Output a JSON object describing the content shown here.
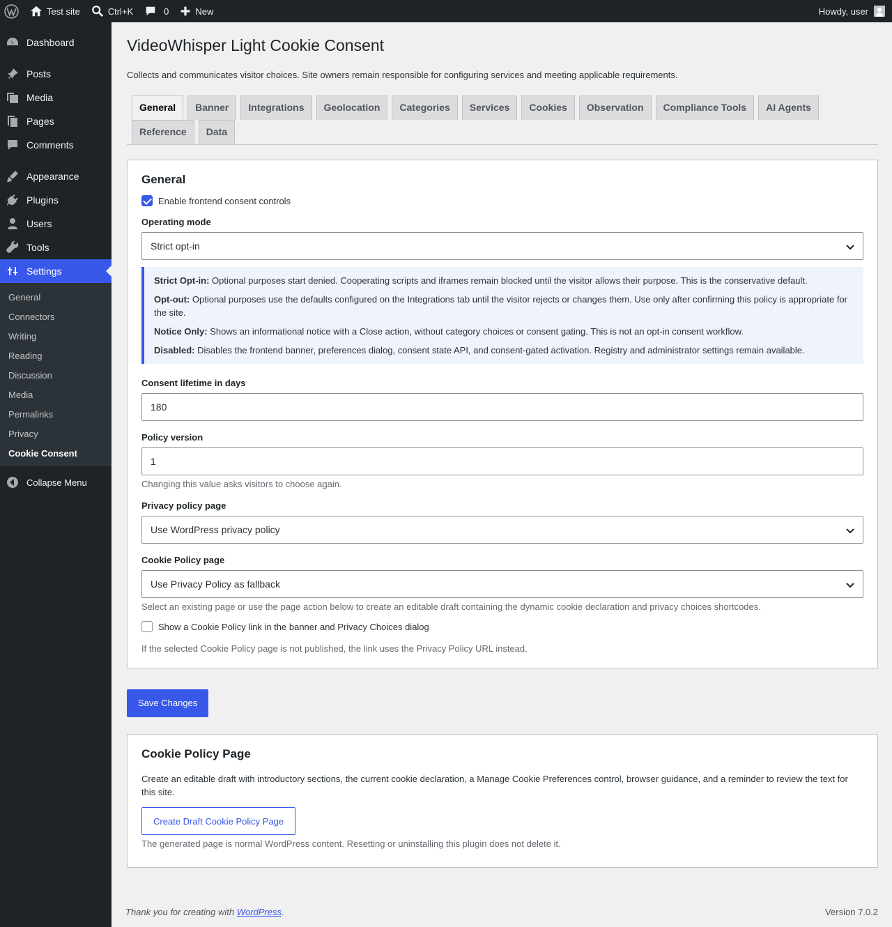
{
  "adminbar": {
    "site_name": "Test site",
    "search_shortcut": "Ctrl+K",
    "comments_count": "0",
    "new_label": "New",
    "howdy": "Howdy, user"
  },
  "sidebar": {
    "items": [
      {
        "label": "Dashboard",
        "icon": "dashboard-icon"
      },
      {
        "label": "Posts",
        "icon": "pin-icon"
      },
      {
        "label": "Media",
        "icon": "media-icon"
      },
      {
        "label": "Pages",
        "icon": "pages-icon"
      },
      {
        "label": "Comments",
        "icon": "comment-icon"
      },
      {
        "label": "Appearance",
        "icon": "brush-icon"
      },
      {
        "label": "Plugins",
        "icon": "plug-icon"
      },
      {
        "label": "Users",
        "icon": "user-icon"
      },
      {
        "label": "Tools",
        "icon": "wrench-icon"
      },
      {
        "label": "Settings",
        "icon": "settings-icon"
      }
    ],
    "submenu": [
      "General",
      "Connectors",
      "Writing",
      "Reading",
      "Discussion",
      "Media",
      "Permalinks",
      "Privacy",
      "Cookie Consent"
    ],
    "collapse": "Collapse Menu"
  },
  "page": {
    "title": "VideoWhisper Light Cookie Consent",
    "description": "Collects and communicates visitor choices. Site owners remain responsible for configuring services and meeting applicable requirements.",
    "tabs": [
      "General",
      "Banner",
      "Integrations",
      "Geolocation",
      "Categories",
      "Services",
      "Cookies",
      "Observation",
      "Compliance Tools",
      "AI Agents",
      "Reference",
      "Data"
    ]
  },
  "general": {
    "heading": "General",
    "enable_label": "Enable frontend consent controls",
    "mode_label": "Operating mode",
    "mode_value": "Strict opt-in",
    "modes": [
      {
        "term": "Strict Opt-in:",
        "text": " Optional purposes start denied. Cooperating scripts and iframes remain blocked until the visitor allows their purpose. This is the conservative default."
      },
      {
        "term": "Opt-out:",
        "text": " Optional purposes use the defaults configured on the Integrations tab until the visitor rejects or changes them. Use only after confirming this policy is appropriate for the site."
      },
      {
        "term": "Notice Only:",
        "text": " Shows an informational notice with a Close action, without category choices or consent gating. This is not an opt-in consent workflow."
      },
      {
        "term": "Disabled:",
        "text": " Disables the frontend banner, preferences dialog, consent state API, and consent-gated activation. Registry and administrator settings remain available."
      }
    ],
    "lifetime_label": "Consent lifetime in days",
    "lifetime_value": "180",
    "version_label": "Policy version",
    "version_value": "1",
    "version_help": "Changing this value asks visitors to choose again.",
    "privacy_label": "Privacy policy page",
    "privacy_value": "Use WordPress privacy policy",
    "cookie_label": "Cookie Policy page",
    "cookie_value": "Use Privacy Policy as fallback",
    "cookie_help": "Select an existing page or use the page action below to create an editable draft containing the dynamic cookie declaration and privacy choices shortcodes.",
    "show_link_label": "Show a Cookie Policy link in the banner and Privacy Choices dialog",
    "show_link_help": "If the selected Cookie Policy page is not published, the link uses the Privacy Policy URL instead."
  },
  "save_label": "Save Changes",
  "policy_card": {
    "heading": "Cookie Policy Page",
    "text": "Create an editable draft with introductory sections, the current cookie declaration, a Manage Cookie Preferences control, browser guidance, and a reminder to review the text for this site.",
    "button": "Create Draft Cookie Policy Page",
    "help": "The generated page is normal WordPress content. Resetting or uninstalling this plugin does not delete it."
  },
  "footer": {
    "thanks_prefix": "Thank you for creating with ",
    "link": "WordPress",
    "suffix": ".",
    "version": "Version 7.0.2"
  },
  "colors": {
    "accent": "#3858e9",
    "sidebar": "#1d2327"
  }
}
